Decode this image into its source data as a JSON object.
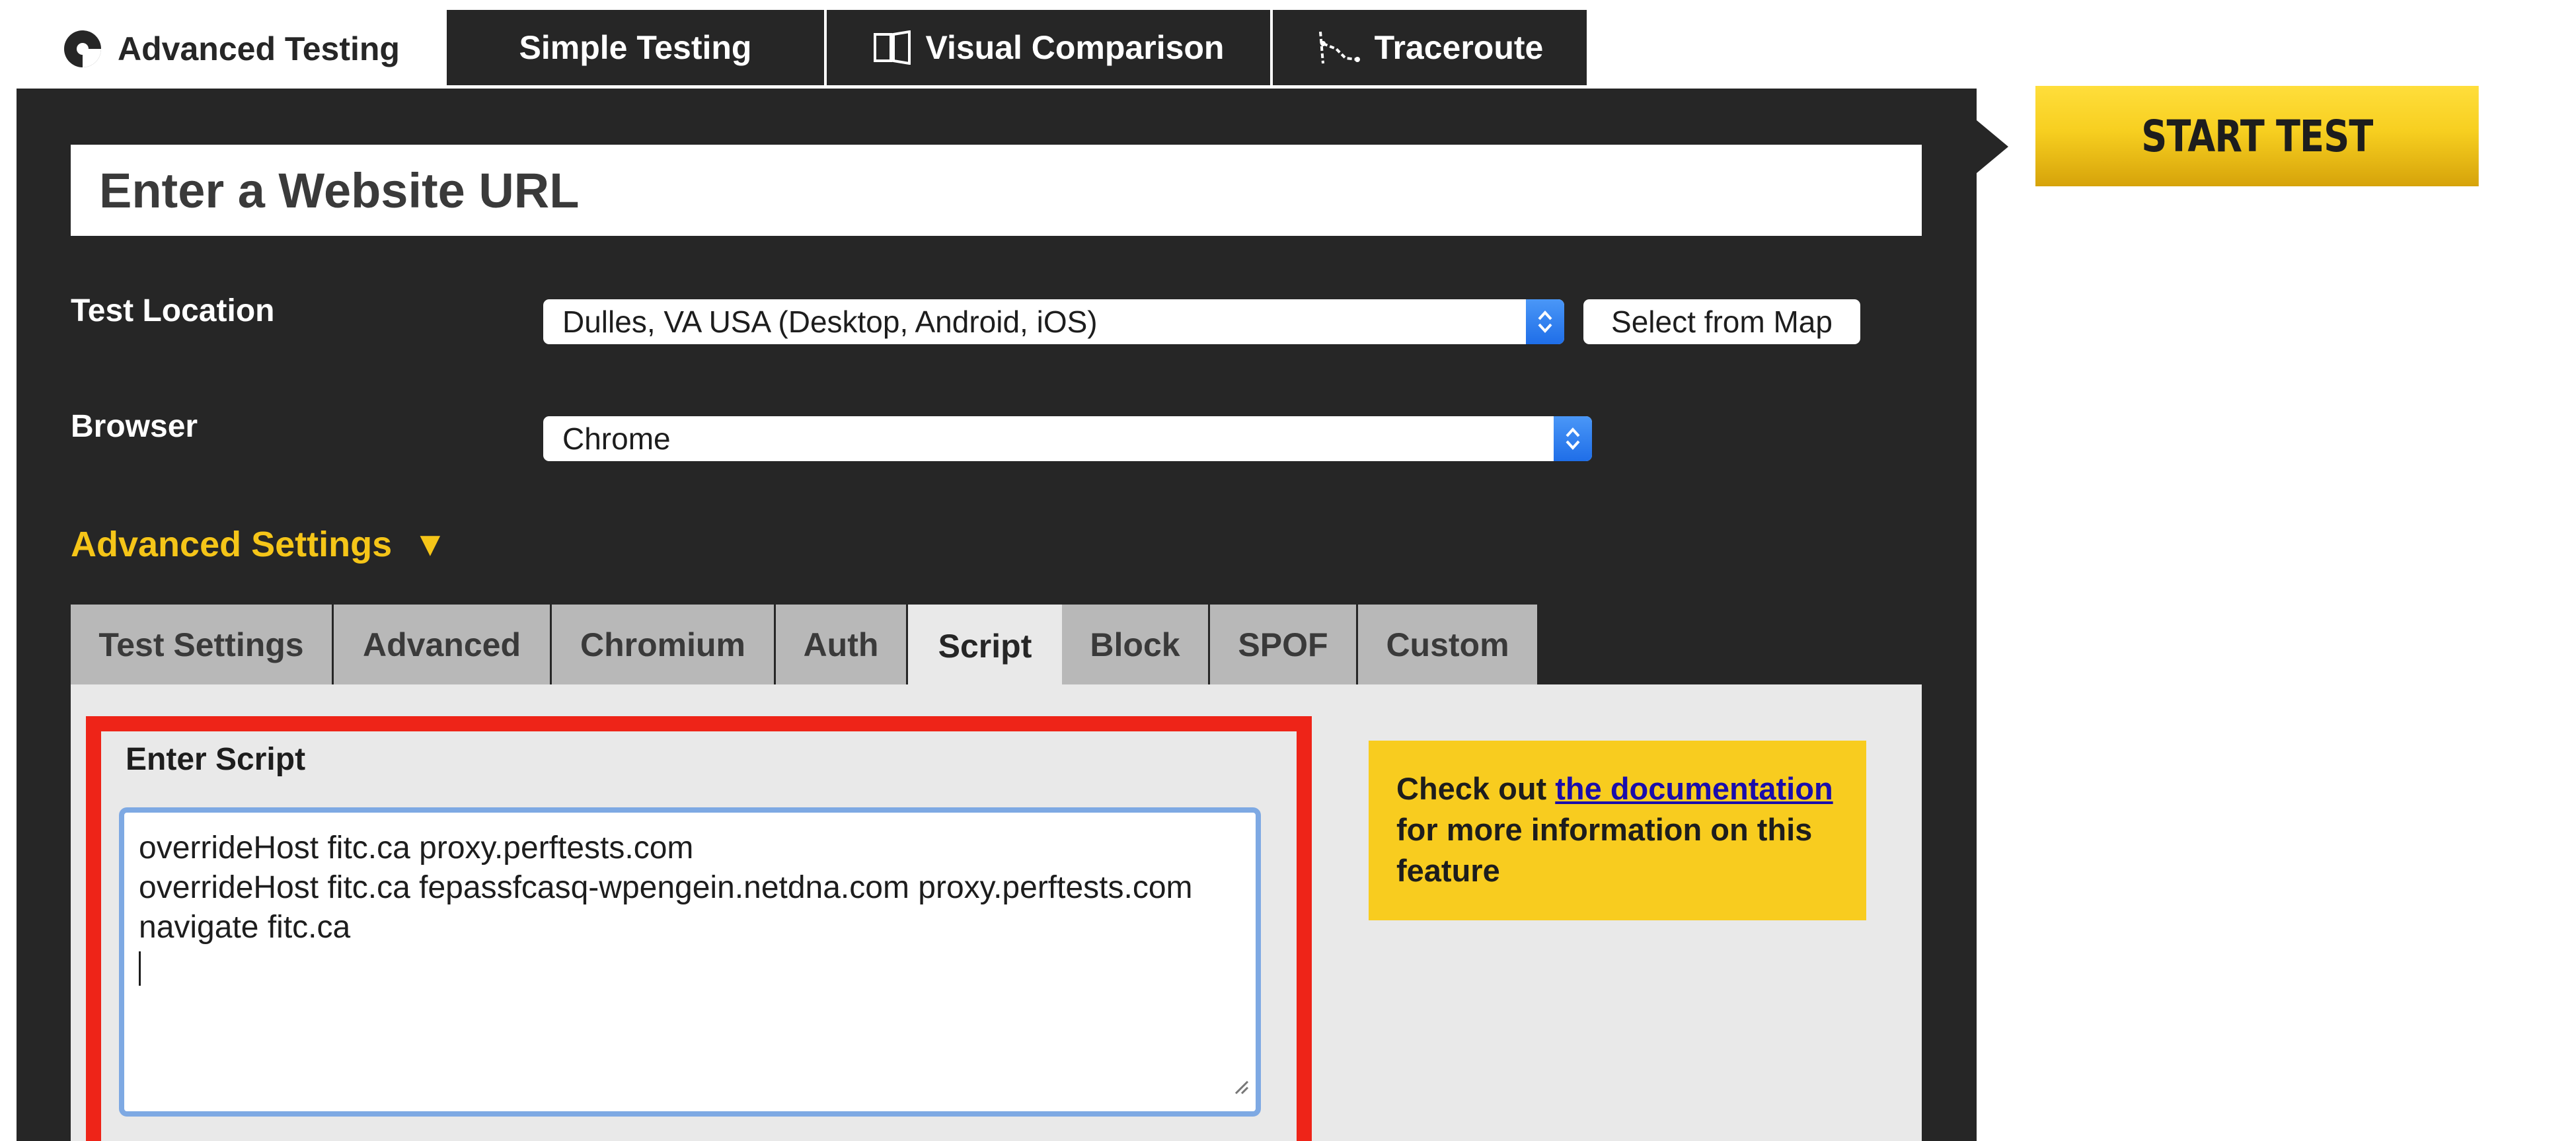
{
  "top_tabs": [
    {
      "label": "Advanced Testing",
      "icon": "logo-icon",
      "active": true
    },
    {
      "label": "Simple Testing",
      "icon": null,
      "active": false
    },
    {
      "label": "Visual Comparison",
      "icon": "compare-icon",
      "active": false
    },
    {
      "label": "Traceroute",
      "icon": "traceroute-icon",
      "active": false
    }
  ],
  "url_input": {
    "placeholder": "Enter a Website URL",
    "value": ""
  },
  "test_location": {
    "label": "Test Location",
    "selected": "Dulles, VA USA (Desktop, Android, iOS)",
    "map_button": "Select from Map"
  },
  "browser": {
    "label": "Browser",
    "selected": "Chrome"
  },
  "advanced_settings": {
    "label": "Advanced Settings",
    "toggle_icon": "caret-down-icon",
    "expanded": true
  },
  "settings_tabs": [
    {
      "label": "Test Settings",
      "active": false
    },
    {
      "label": "Advanced",
      "active": false
    },
    {
      "label": "Chromium",
      "active": false
    },
    {
      "label": "Auth",
      "active": false
    },
    {
      "label": "Script",
      "active": true
    },
    {
      "label": "Block",
      "active": false
    },
    {
      "label": "SPOF",
      "active": false
    },
    {
      "label": "Custom",
      "active": false
    }
  ],
  "script": {
    "label": "Enter Script",
    "lines": [
      "overrideHost fitc.ca proxy.perftests.com",
      "overrideHost fitc.ca fepassfcasq-wpengein.netdna.com proxy.perftests.com",
      "navigate fitc.ca"
    ]
  },
  "doc_note": {
    "prefix": "Check out ",
    "link": "the documentation",
    "suffix": " for more information on this feature"
  },
  "start_button": "START TEST",
  "colors": {
    "panel": "#262626",
    "accent_yellow": "#f5c518",
    "highlight_red": "#ee2418",
    "select_arrow_blue": "#2b7ef0",
    "link": "#1a0dab"
  }
}
